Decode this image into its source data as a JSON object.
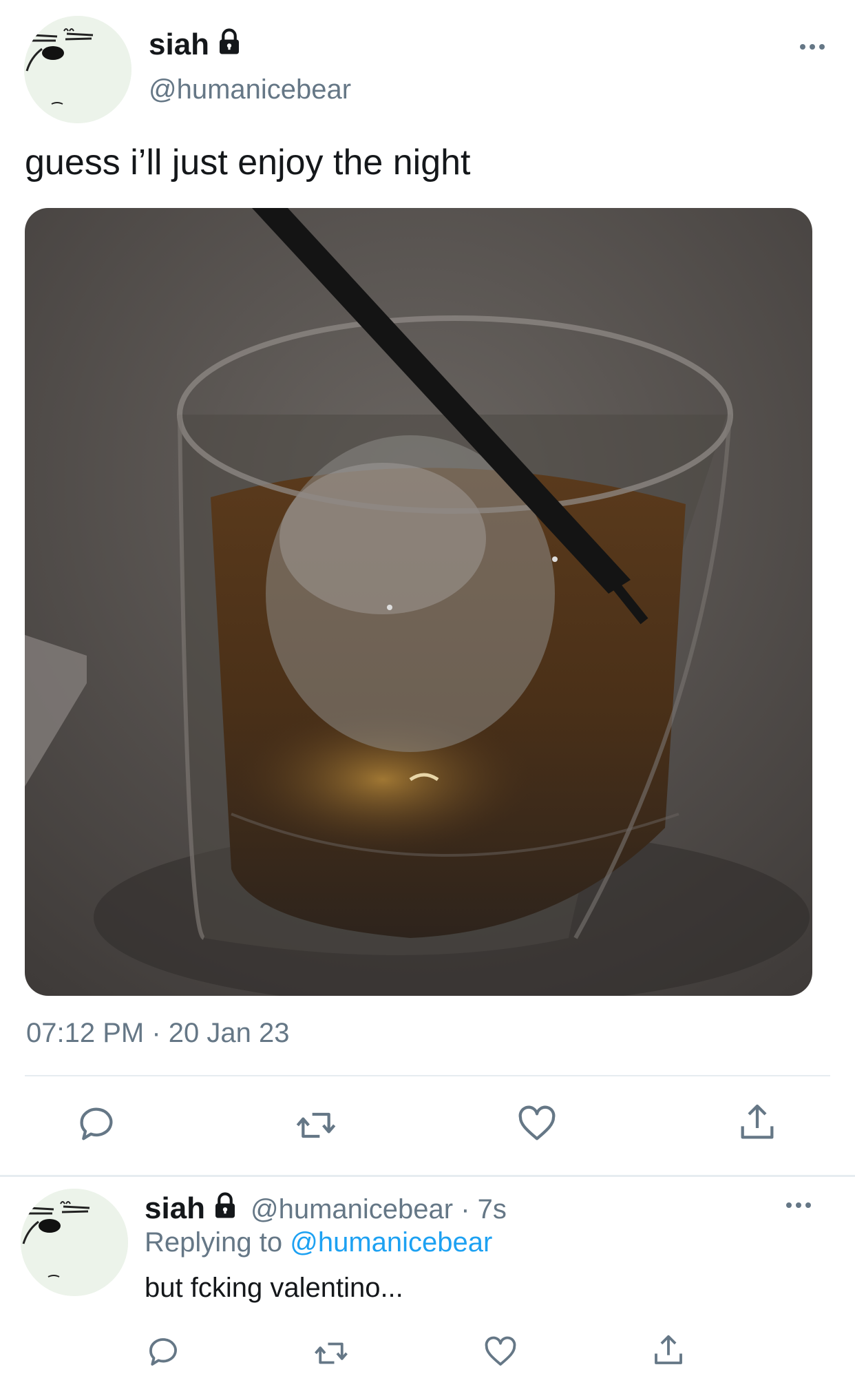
{
  "colors": {
    "text_primary": "#14171a",
    "text_secondary": "#657786",
    "link": "#1da1f2",
    "divider": "#e6ecf0",
    "icon": "#657786"
  },
  "tweet": {
    "display_name": "siah",
    "handle": "@humanicebear",
    "protected_icon": "lock-icon",
    "text": "guess i’ll just enjoy the night",
    "timestamp": "07:12 PM · 20 Jan 23",
    "actions": [
      "reply-icon",
      "retweet-icon",
      "like-icon",
      "share-icon"
    ]
  },
  "reply": {
    "display_name": "siah",
    "meta": "@humanicebear · 7s",
    "replying_prefix": "Replying to ",
    "replying_to": "@humanicebear",
    "text": "but fcking valentino..."
  }
}
